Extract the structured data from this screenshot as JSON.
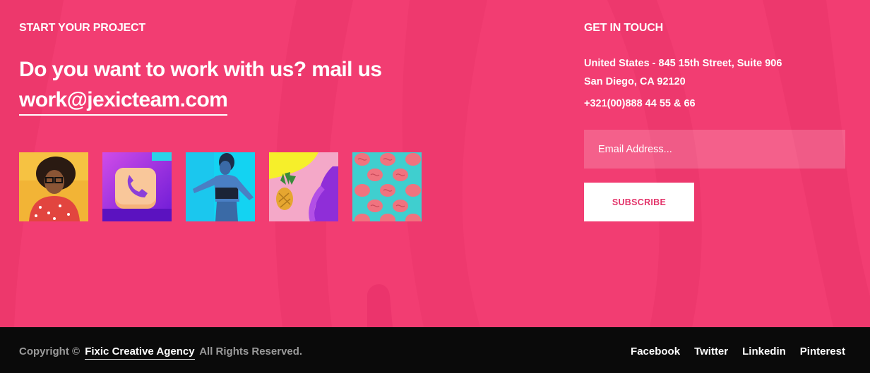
{
  "start_project": {
    "heading": "START YOUR PROJECT",
    "pitch": "Do you want to work with us? mail us",
    "email": "work@jexicteam.com",
    "gallery": [
      {
        "icon": "woman-portrait-yellow-image"
      },
      {
        "icon": "phone-app-icon-image"
      },
      {
        "icon": "fitness-woman-cyan-image"
      },
      {
        "icon": "pineapple-pop-art-image"
      },
      {
        "icon": "pink-brains-pattern-image"
      }
    ]
  },
  "get_in_touch": {
    "heading": "GET IN TOUCH",
    "address_line1": "United States - 845 15th Street, Suite 906",
    "address_line2": "San Diego, CA 92120",
    "phone": "+321(00)888 44 55 & 66",
    "email_placeholder": "Email Address...",
    "subscribe_label": "SUBSCRIBE"
  },
  "footer": {
    "copyright_prefix": "Copyright ©",
    "brand": "Fixic Creative Agency",
    "copyright_suffix": "All Rights Reserved.",
    "social": [
      {
        "label": "Facebook"
      },
      {
        "label": "Twitter"
      },
      {
        "label": "Linkedin"
      },
      {
        "label": "Pinterest"
      }
    ]
  },
  "colors": {
    "accent_pink": "#f23d72",
    "footer_bg": "#0a0a0a",
    "button_text": "#e3346a"
  }
}
